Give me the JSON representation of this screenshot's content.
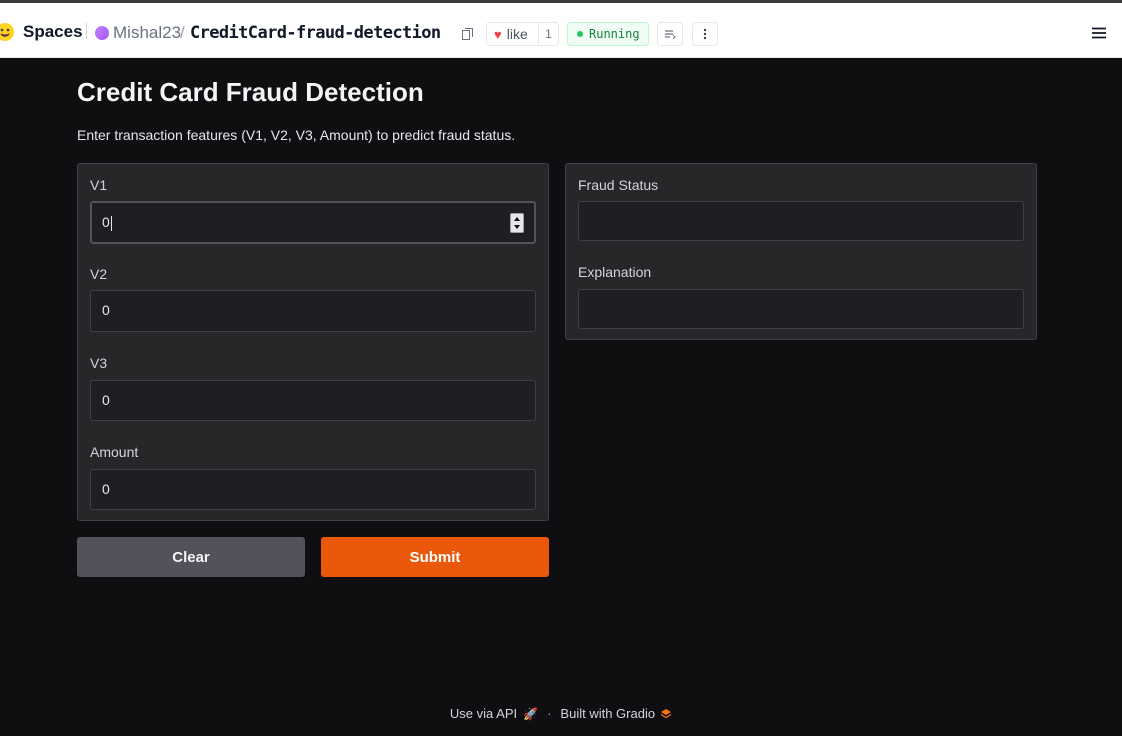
{
  "header": {
    "brand": "Spaces",
    "owner": "Mishal23",
    "repo": "CreditCard-fraud-detection",
    "like_label": "like",
    "like_count": "1",
    "status": "Running"
  },
  "app": {
    "title": "Credit Card Fraud Detection",
    "description": "Enter transaction features (V1, V2, V3, Amount) to predict fraud status."
  },
  "inputs": [
    {
      "label": "V1",
      "value": "0"
    },
    {
      "label": "V2",
      "value": "0"
    },
    {
      "label": "V3",
      "value": "0"
    },
    {
      "label": "Amount",
      "value": "0"
    }
  ],
  "outputs": [
    {
      "label": "Fraud Status",
      "value": ""
    },
    {
      "label": "Explanation",
      "value": ""
    }
  ],
  "buttons": {
    "clear": "Clear",
    "submit": "Submit"
  },
  "footer": {
    "api": "Use via API",
    "built": "Built with Gradio"
  },
  "colors": {
    "accent": "#ea580c",
    "background": "#0f0f11",
    "panel": "#27272a",
    "running": "#22c55e"
  }
}
